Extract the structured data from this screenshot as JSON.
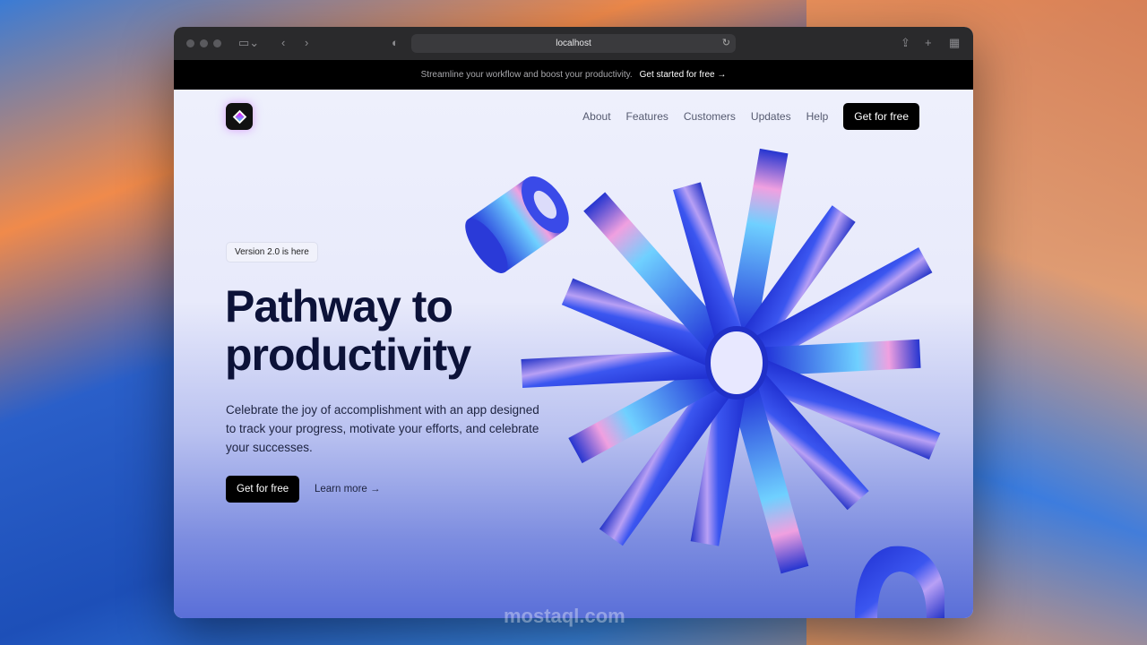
{
  "browser": {
    "url": "localhost"
  },
  "banner": {
    "text": "Streamline your workflow and boost your productivity.",
    "link": "Get started for free →"
  },
  "nav": {
    "items": [
      "About",
      "Features",
      "Customers",
      "Updates",
      "Help"
    ],
    "cta": "Get for free"
  },
  "hero": {
    "badge": "Version 2.0 is here",
    "title_line1": "Pathway to",
    "title_line2": "productivity",
    "description": "Celebrate the joy of accomplishment with an app designed to track your progress, motivate your efforts, and celebrate your successes.",
    "primary_button": "Get for free",
    "secondary_button": "Learn more →"
  },
  "watermark": "mostaql.com",
  "colors": {
    "accent": "#2b3fd6",
    "heading": "#0c1238",
    "cta_bg": "#000000"
  }
}
